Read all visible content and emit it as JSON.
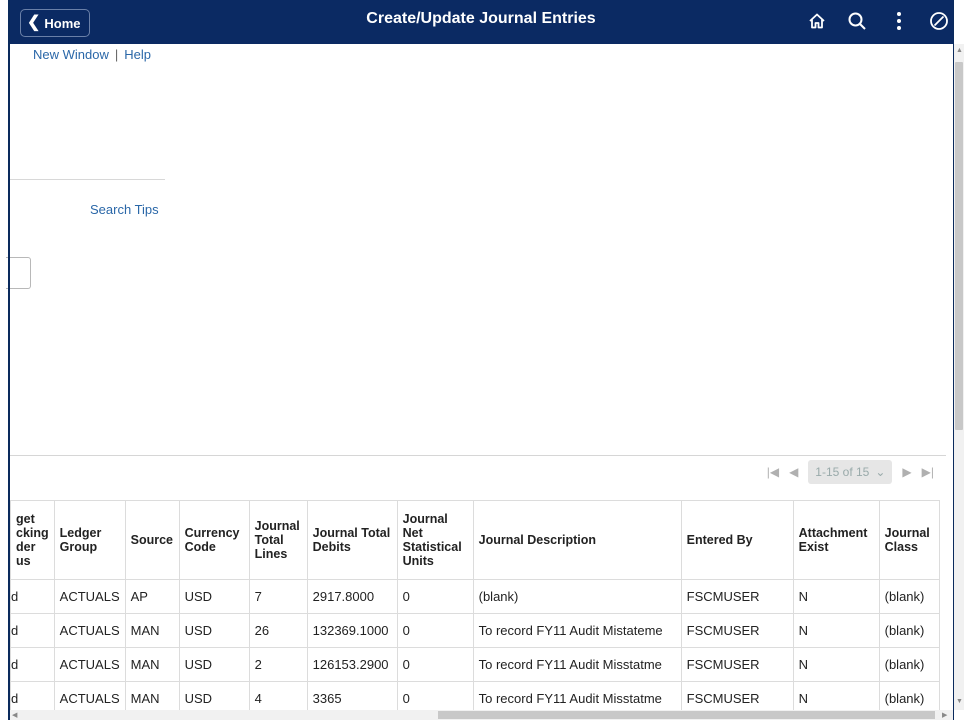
{
  "header": {
    "home_label": "Home",
    "title": "Create/Update Journal Entries",
    "icons": [
      "home-icon",
      "search-icon",
      "more-vertical-icon",
      "navbar-compass-icon"
    ],
    "bg_color": "#0b2a63"
  },
  "links": {
    "new_window": "New Window",
    "separator": "|",
    "help": "Help",
    "search_tips": "Search Tips"
  },
  "pager": {
    "range": "1-15 of 15"
  },
  "grid": {
    "columns": [
      "get\ncking\nder\nus",
      "Ledger Group",
      "Source",
      "Currency Code",
      "Journal Total Lines",
      "Journal Total Debits",
      "Journal Net Statistical Units",
      "Journal Description",
      "Entered By",
      "Attachment Exist",
      "Journal Class"
    ],
    "rows": [
      [
        "d",
        "ACTUALS",
        "AP",
        "USD",
        "7",
        "2917.8000",
        "0",
        "(blank)",
        "FSCMUSER",
        "N",
        "(blank)"
      ],
      [
        "d",
        "ACTUALS",
        "MAN",
        "USD",
        "26",
        "132369.1000",
        "0",
        "To record FY11 Audit Mistateme",
        "FSCMUSER",
        "N",
        "(blank)"
      ],
      [
        "d",
        "ACTUALS",
        "MAN",
        "USD",
        "2",
        "126153.2900",
        "0",
        "To record FY11 Audit Misstatme",
        "FSCMUSER",
        "N",
        "(blank)"
      ],
      [
        "d",
        "ACTUALS",
        "MAN",
        "USD",
        "4",
        "3365",
        "0",
        "To record FY11 Audit Misstatme",
        "FSCMUSER",
        "N",
        "(blank)"
      ]
    ]
  }
}
